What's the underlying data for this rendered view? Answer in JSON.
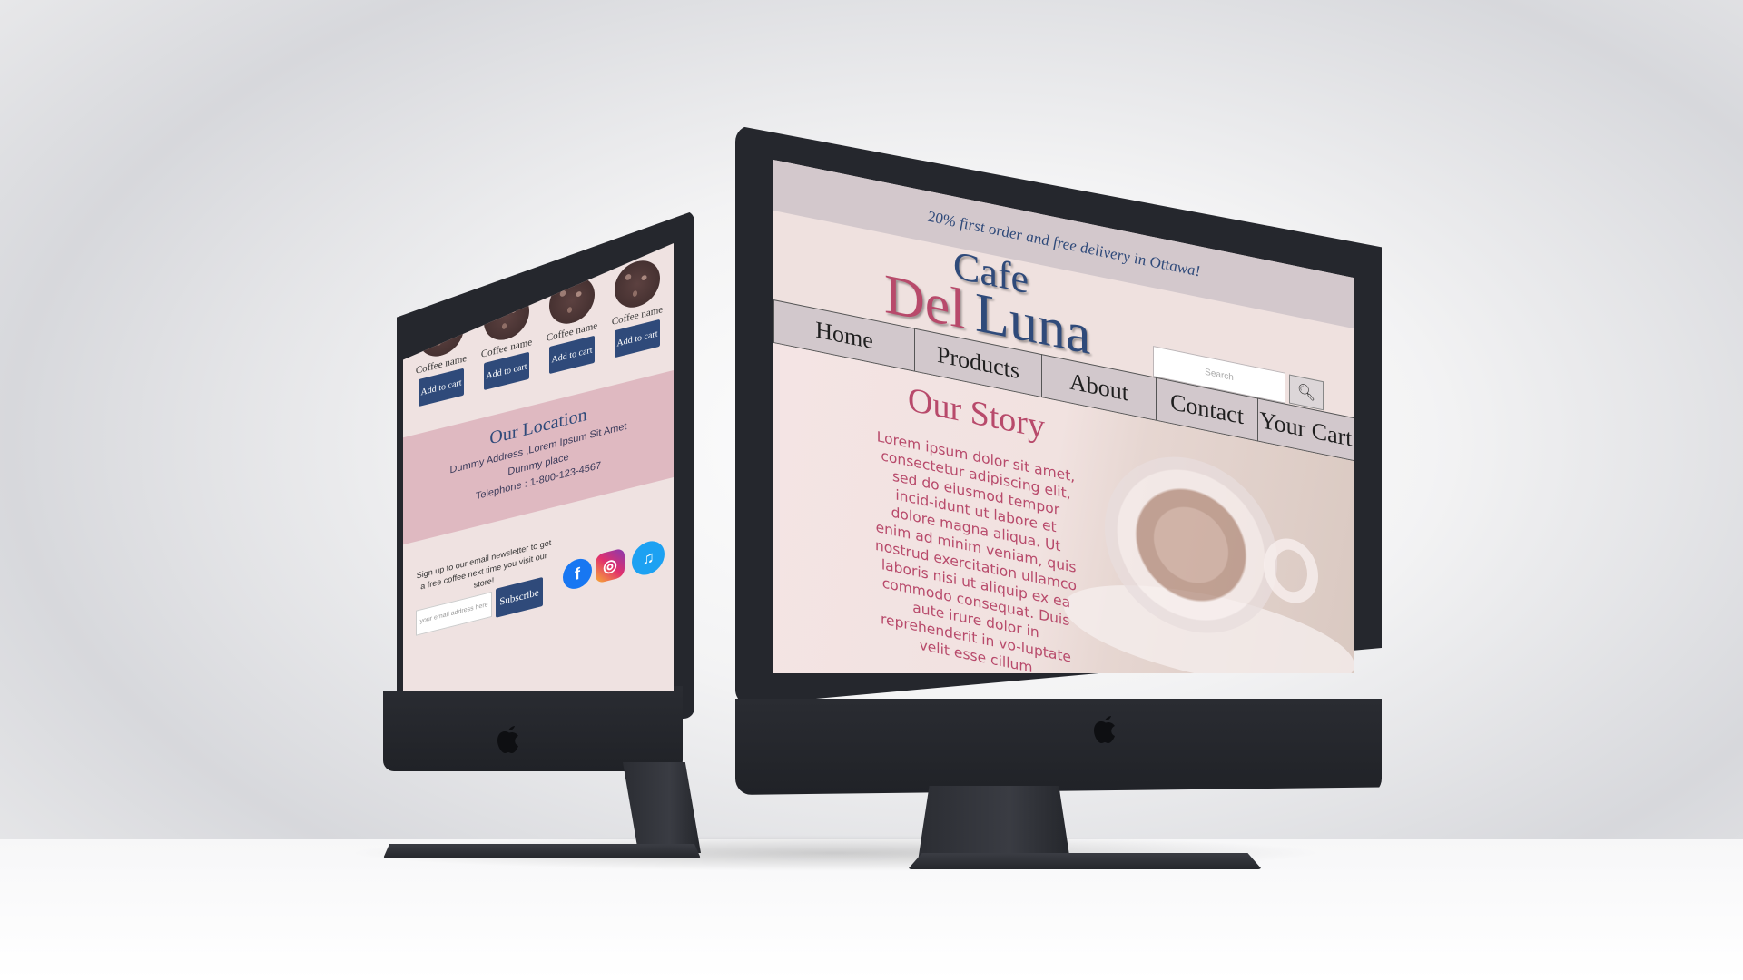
{
  "left_screen": {
    "products": [
      {
        "name": "Coffee name",
        "button": "Add to cart"
      },
      {
        "name": "Coffee name",
        "button": "Add to cart"
      },
      {
        "name": "Coffee name",
        "button": "Add to cart"
      },
      {
        "name": "Coffee name",
        "button": "Add to cart"
      }
    ],
    "location": {
      "title": "Our Location",
      "address": "Dummy Address ,Lorem Ipsum Sit Amet",
      "place": "Dummy place",
      "telephone": "Telephone : 1-800-123-4567"
    },
    "newsletter": {
      "text": "Sign up to our email newsletter to get a free coffee next time you visit our store!",
      "placeholder": "your email address here",
      "button": "Subscribe"
    },
    "social_icons": [
      "facebook-icon",
      "instagram-icon",
      "twitter-icon"
    ]
  },
  "right_screen": {
    "banner": "20% first order and free delivery in Ottawa!",
    "brand": {
      "line1": "Cafe",
      "word1": "Del",
      "word2": "Luna"
    },
    "search": {
      "placeholder": "Search"
    },
    "nav": [
      "Home",
      "Products",
      "About",
      "Contact",
      "Your Cart"
    ],
    "story": {
      "title": "Our Story",
      "text": "Lorem ipsum dolor sit amet, consectetur adipiscing elit, sed do eiusmod tempor incid-idunt ut labore et dolore magna aliqua. Ut enim ad minim veniam, quis nostrud exercitation ullamco laboris nisi ut aliquip ex ea commodo consequat. Duis aute irure dolor in reprehenderit in vo-luptate velit esse cillum"
    }
  },
  "colors": {
    "brand_pink": "#b84a6b",
    "brand_blue": "#2f4a7a",
    "location_band": "#dfb9c1",
    "page_bg": "#efe1df"
  }
}
